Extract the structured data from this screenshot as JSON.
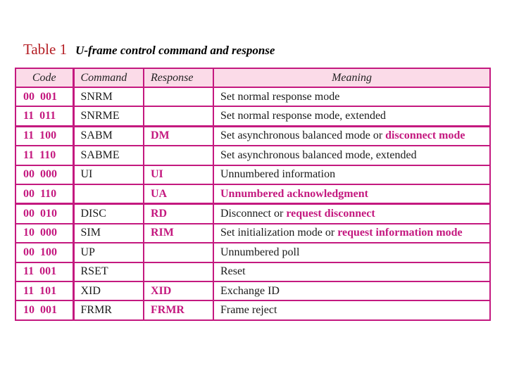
{
  "caption": {
    "label": "Table 1",
    "title": "U-frame control command and response"
  },
  "colors": {
    "accent": "#c4197f",
    "header_bg": "#fbdbe8",
    "caption_label": "#b41e24"
  },
  "table": {
    "headers": {
      "code": "Code",
      "command": "Command",
      "response": "Response",
      "meaning": "Meaning"
    },
    "rows": [
      {
        "code": "00 001",
        "command": "SNRM",
        "response": "",
        "meaning_plain": "Set normal response mode",
        "meaning_highlight": ""
      },
      {
        "code": "11 011",
        "command": "SNRME",
        "response": "",
        "meaning_plain": "Set normal response mode, extended",
        "meaning_highlight": ""
      },
      {
        "code": "11 100",
        "command": "SABM",
        "response": "DM",
        "meaning_plain": "Set asynchronous balanced mode or ",
        "meaning_highlight": "disconnect mode"
      },
      {
        "code": "11 110",
        "command": "SABME",
        "response": "",
        "meaning_plain": "Set asynchronous balanced mode, extended",
        "meaning_highlight": ""
      },
      {
        "code": "00 000",
        "command": "UI",
        "response": "UI",
        "meaning_plain": "Unnumbered information",
        "meaning_highlight": ""
      },
      {
        "code": "00 110",
        "command": "",
        "response": "UA",
        "meaning_plain": "",
        "meaning_highlight": "Unnumbered acknowledgment"
      },
      {
        "code": "00 010",
        "command": "DISC",
        "response": "RD",
        "meaning_plain": "Disconnect or ",
        "meaning_highlight": "request disconnect"
      },
      {
        "code": "10 000",
        "command": "SIM",
        "response": "RIM",
        "meaning_plain": "Set initialization mode or ",
        "meaning_highlight": "request information mode"
      },
      {
        "code": "00 100",
        "command": "UP",
        "response": "",
        "meaning_plain": "Unnumbered poll",
        "meaning_highlight": ""
      },
      {
        "code": "11 001",
        "command": "RSET",
        "response": "",
        "meaning_plain": "Reset",
        "meaning_highlight": ""
      },
      {
        "code": "11 101",
        "command": "XID",
        "response": "XID",
        "meaning_plain": "Exchange ID",
        "meaning_highlight": ""
      },
      {
        "code": "10 001",
        "command": "FRMR",
        "response": "FRMR",
        "meaning_plain": "Frame reject",
        "meaning_highlight": ""
      }
    ]
  }
}
